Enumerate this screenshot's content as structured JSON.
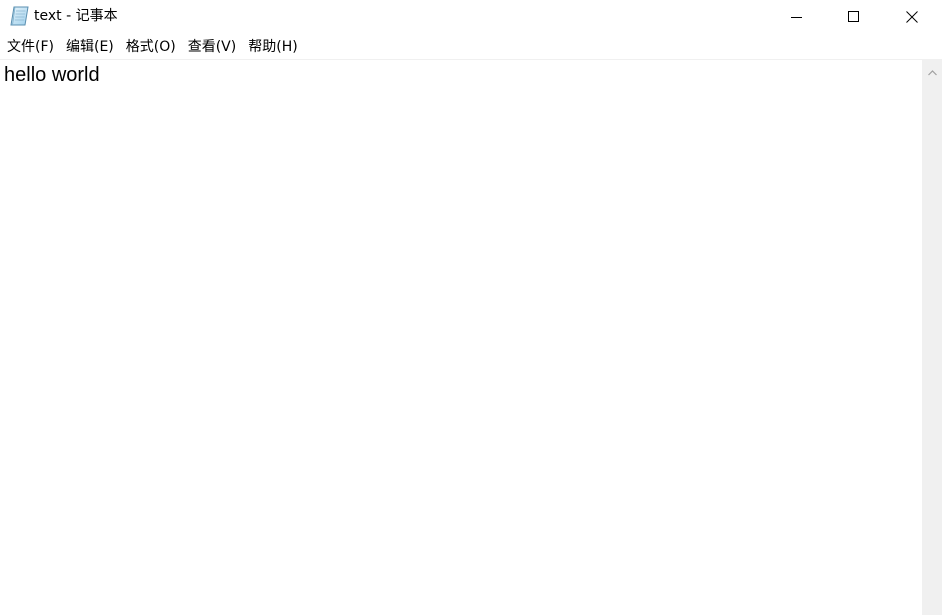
{
  "window": {
    "title": "text - 记事本",
    "app_icon": "notepad-icon",
    "controls": {
      "minimize_icon": "minimize-icon",
      "maximize_icon": "maximize-icon",
      "close_icon": "close-icon"
    }
  },
  "menu": {
    "items": [
      {
        "label": "文件(F)"
      },
      {
        "label": "编辑(E)"
      },
      {
        "label": "格式(O)"
      },
      {
        "label": "查看(V)"
      },
      {
        "label": "帮助(H)"
      }
    ]
  },
  "editor": {
    "content": "hello world"
  },
  "scrollbar": {
    "up_icon": "chevron-up-icon"
  },
  "colors": {
    "window_bg": "#ffffff",
    "scrollbar_bg": "#f0f0f0",
    "text": "#000000"
  }
}
